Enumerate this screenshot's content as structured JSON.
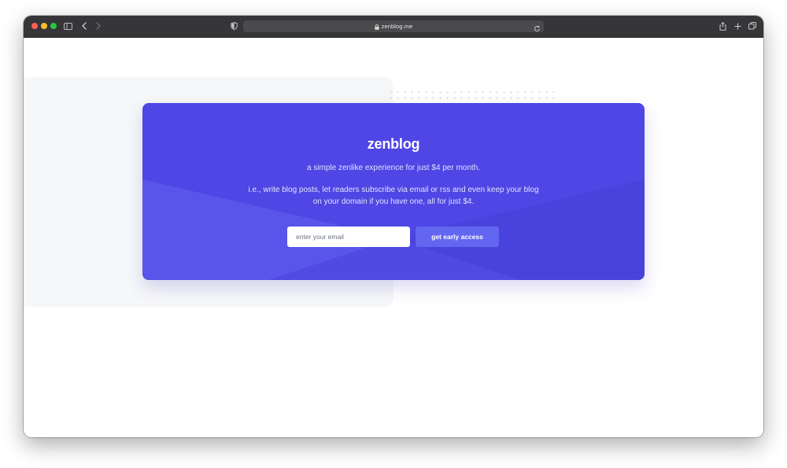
{
  "browser": {
    "url": "zenblog.me",
    "icons": [
      "sidebar-icon",
      "back-icon",
      "forward-icon",
      "shield-icon",
      "lock-icon",
      "reload-icon",
      "share-icon",
      "new-tab-icon",
      "tabs-overview-icon"
    ]
  },
  "hero": {
    "title": "zenblog",
    "tagline": "a simple zenlike experience for just $4 per month.",
    "description_line1": "i.e., write blog posts, let readers subscribe via email or rss and even keep your blog",
    "description_line2": "on your domain if you have one, all for just $4.",
    "email_placeholder": "enter your email",
    "cta_label": "get early access"
  },
  "colors": {
    "card": "#4f46e5",
    "button": "#6366f1",
    "titlebar": "#363537"
  }
}
